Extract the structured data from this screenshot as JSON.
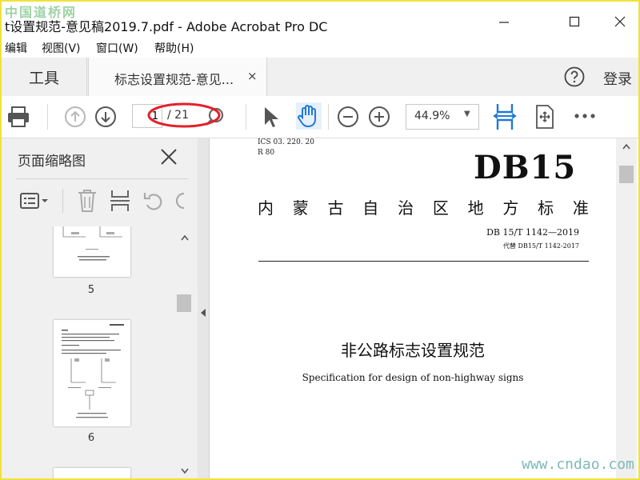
{
  "watermark": {
    "top": "中国道桥网",
    "bottom": "www.cndao.com"
  },
  "window": {
    "title": "t设置规范-意见稿2019.7.pdf - Adobe Acrobat Pro DC"
  },
  "menu": [
    "编辑",
    "视图(V)",
    "窗口(W)",
    "帮助(H)"
  ],
  "tabs": {
    "tools": "工具",
    "document": "标志设置规范-意见...",
    "close": "×",
    "login": "登录"
  },
  "toolbar": {
    "current_page": "1",
    "total_pages": "/ 21",
    "zoom": "44.9%",
    "annotation_color": "#e3202a"
  },
  "sidebar": {
    "title": "页面缩略图",
    "thumbnails": [
      {
        "label": "5"
      },
      {
        "label": "6"
      }
    ]
  },
  "document": {
    "ics": "ICS  03. 220. 20",
    "r": "R  80",
    "code_logo": "DB15",
    "standard_chars": [
      "内",
      "蒙",
      "古",
      "自",
      "治",
      "区",
      "地",
      "方",
      "标",
      "准"
    ],
    "standard_code": "DB 15/T  1142—2019",
    "replaces": "代替  DB15/T  1142-2017",
    "title": "非公路标志设置规范",
    "subtitle": "Specification for design of non-highway signs"
  },
  "colors": {
    "frame": "#f1e23a",
    "accent_blue": "#1f7ad6"
  }
}
